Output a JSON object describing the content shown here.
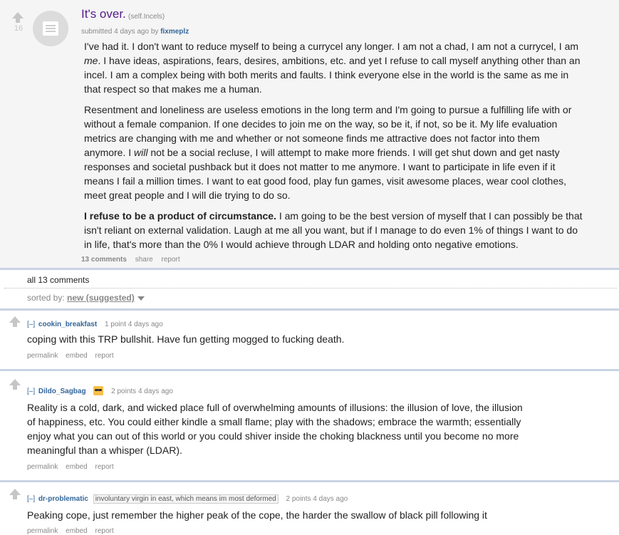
{
  "post": {
    "score": "16",
    "title": "It's over.",
    "domain": "(self.Incels)",
    "tagline_prefix": "submitted 4 days ago by",
    "author": "fixmeplz",
    "paragraphs": [
      "I've had it. I don't want to reduce myself to being a currycel any longer. I am not a chad, I am not a currycel, I am me. I have ideas, aspirations, fears, desires, ambitions, etc. and yet I refuse to call myself anything other than an incel. I am a complex being with both merits and faults. I think everyone else in the world is the same as me in that respect so that makes me a human.",
      "Resentment and loneliness are useless emotions in the long term and I'm going to pursue a fulfilling life with or without a female companion. If one decides to join me on the way, so be it, if not, so be it. My life evaluation metrics are changing with me and whether or not someone finds me attractive does not factor into them anymore. I will not be a social recluse, I will attempt to make more friends. I will get shut down and get nasty responses and societal pushback but it does not matter to me anymore. I want to participate in life even if it means I fail a million times. I want to eat good food, play fun games, visit awesome places, wear cool clothes, meet great people and I will die trying to do so.",
      "I refuse to be a product of circumstance. I am going to be the best version of myself that I can possibly be that isn't reliant on external validation. Laugh at me all you want, but if I manage to do even 1% of things I want to do in life, that's more than the 0% I would achieve through LDAR and holding onto negative emotions."
    ],
    "p3_bold": "I refuse to be a product of circumstance.",
    "p3_rest": " I am going to be the best version of myself that I can possibly be that isn't reliant on external validation. Laugh at me all you want, but if I manage to do even 1% of things I want to do in life, that's more than the 0% I would achieve through LDAR and holding onto negative emotions.",
    "buttons": {
      "comments": "13 comments",
      "share": "share",
      "report": "report"
    }
  },
  "comments_header": {
    "all_label": "all 13 comments",
    "sorted_label": "sorted by:",
    "sorted_value": "new (suggested)"
  },
  "comments": [
    {
      "toggle": "[–]",
      "author": "cookin_breakfast",
      "meta": "1 point 4 days ago",
      "body": "coping with this TRP bullshit. Have fun getting mogged to fucking death.",
      "buttons": [
        "permalink",
        "embed",
        "report"
      ]
    },
    {
      "toggle": "[–]",
      "author": "Dildo_Sagbag",
      "meta": "2 points 4 days ago",
      "flair_icon": "sunglasses-emoji-icon",
      "body": "Reality is a cold, dark, and wicked place full of overwhelming amounts of illusions: the illusion of love, the illusion of happiness, etc. You could either kindle a small flame; play with the shadows; embrace the warmth; essentially enjoy what you can out of this world or you could shiver inside the choking blackness until you become no more meaningful than a whisper (LDAR).",
      "buttons": [
        "permalink",
        "embed",
        "report"
      ]
    },
    {
      "toggle": "[–]",
      "author": "dr-problematic",
      "flair": "involuntary virgin in east, which means im most deformed",
      "meta": "2 points 4 days ago",
      "body": "Peaking cope, just remember the higher peak of the cope, the harder the swallow of black pill following it",
      "buttons": [
        "permalink",
        "embed",
        "report"
      ]
    }
  ],
  "colors": {
    "title": "#551a8b",
    "author": "#336699",
    "separator": "#c9d3e3",
    "post_bg": "#f5f5f5"
  }
}
